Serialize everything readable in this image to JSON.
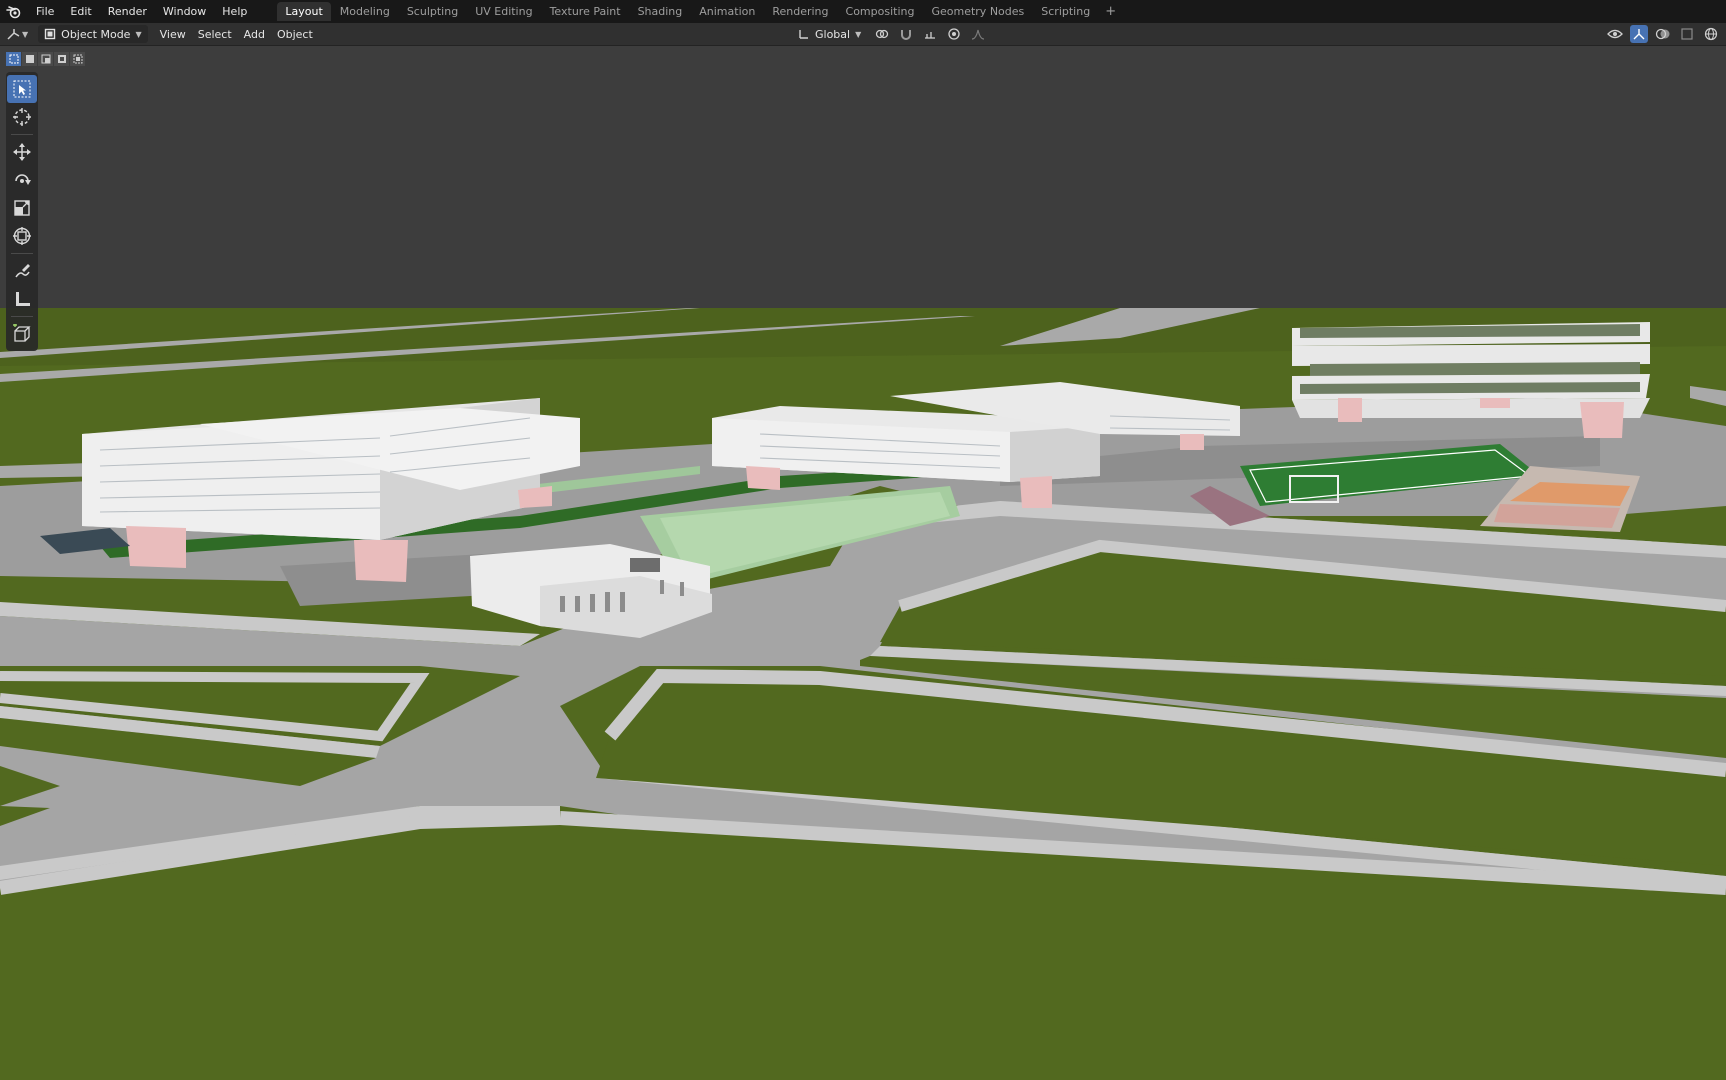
{
  "menu": {
    "logo": "blender-logo-icon",
    "items": [
      "File",
      "Edit",
      "Render",
      "Window",
      "Help"
    ]
  },
  "workspaces": {
    "tabs": [
      "Layout",
      "Modeling",
      "Sculpting",
      "UV Editing",
      "Texture Paint",
      "Shading",
      "Animation",
      "Rendering",
      "Compositing",
      "Geometry Nodes",
      "Scripting"
    ],
    "active": "Layout",
    "add_label": "+"
  },
  "header": {
    "mode": "Object Mode",
    "menus": [
      "View",
      "Select",
      "Add",
      "Object"
    ],
    "transform_orientation": "Global"
  },
  "toolbar": {
    "tools": [
      {
        "name": "select-box-tool",
        "icon": "cursor-arrow-icon",
        "active": true
      },
      {
        "name": "cursor-tool",
        "icon": "crosshair-icon",
        "active": false
      },
      {
        "name": "move-tool",
        "icon": "move-arrows-icon",
        "active": false
      },
      {
        "name": "rotate-tool",
        "icon": "rotate-icon",
        "active": false
      },
      {
        "name": "scale-tool",
        "icon": "scale-icon",
        "active": false
      },
      {
        "name": "transform-tool",
        "icon": "transform-icon",
        "active": false
      },
      {
        "name": "annotate-tool",
        "icon": "pencil-icon",
        "active": false
      },
      {
        "name": "measure-tool",
        "icon": "ruler-icon",
        "active": false
      },
      {
        "name": "add-cube-tool",
        "icon": "cube-add-icon",
        "active": false
      }
    ]
  },
  "colors": {
    "accent": "#4772b3",
    "sky": "#3d3d3d",
    "grass": "#52691f",
    "road": "#a5a5a5",
    "road_edge": "#c9c9c9",
    "building": "#e8e8e8",
    "pillar": "#e9bcbc",
    "field": "#2f7d36"
  }
}
